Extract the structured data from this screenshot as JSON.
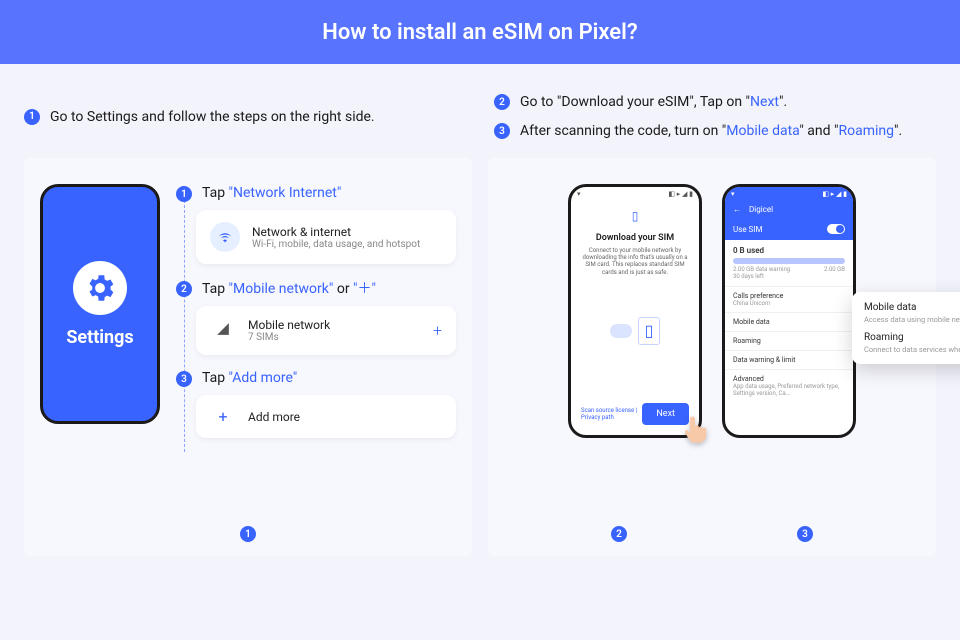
{
  "header": {
    "title": "How to install an eSIM on Pixel?"
  },
  "top": {
    "left": {
      "num": "1",
      "text": "Go to Settings and follow the steps on the right side."
    },
    "right": [
      {
        "num": "2",
        "pre": "Go to \"Download your eSIM\", Tap on \"",
        "hl": "Next",
        "post": "\"."
      },
      {
        "num": "3",
        "pre": "After scanning the code, turn on \"",
        "hl1": "Mobile data",
        "mid": "\" and \"",
        "hl2": "Roaming",
        "post": "\"."
      }
    ]
  },
  "leftPanel": {
    "phoneLabel": "Settings",
    "steps": [
      {
        "num": "1",
        "tap": "Tap ",
        "hl": "\"Network Internet\"",
        "card": {
          "title": "Network & internet",
          "sub": "Wi-Fi, mobile, data usage, and hotspot"
        }
      },
      {
        "num": "2",
        "tap": "Tap ",
        "hl": "\"Mobile network\"",
        "or": " or ",
        "hl2": "\"＋\"",
        "card": {
          "title": "Mobile network",
          "sub": "7 SIMs"
        }
      },
      {
        "num": "3",
        "tap": "Tap ",
        "hl": "\"Add more\"",
        "card": {
          "title": "Add more"
        }
      }
    ],
    "bottomNum": "1"
  },
  "rightPanel": {
    "phone1": {
      "title": "Download your SIM",
      "desc": "Connect to your mobile network by downloading the info that's usually on a SIM card. This replaces standard SIM cards and is just as safe.",
      "link": "Scan source license | Privacy path",
      "next": "Next"
    },
    "phone2": {
      "carrier": "Digicel",
      "useSim": "Use SIM",
      "usedLabel": "0 B used",
      "warn": "2.00 GB data warning",
      "days": "30 days left",
      "limit": "2.00 GB",
      "rows": [
        {
          "t": "Calls preference",
          "s": "China Unicom"
        },
        {
          "t": "Mobile data",
          "s": ""
        },
        {
          "t": "Roaming",
          "s": ""
        },
        {
          "t": "Data warning & limit",
          "s": ""
        },
        {
          "t": "Advanced",
          "s": "App data usage, Preferred network type, Settings version, Ca..."
        }
      ]
    },
    "floatCard": {
      "r1": {
        "t": "Mobile data",
        "s": "Access data using mobile network"
      },
      "r2": {
        "t": "Roaming",
        "s": "Connect to data services when roaming"
      }
    },
    "bottomNums": [
      "2",
      "3"
    ]
  }
}
